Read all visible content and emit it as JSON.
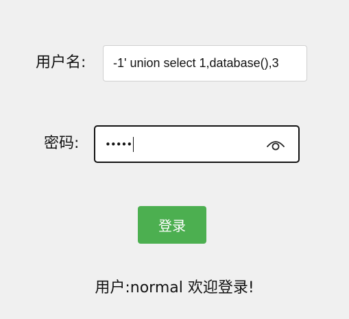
{
  "form": {
    "username_label": "用户名:",
    "username_value": "-1' union select 1,database(),3",
    "password_label": "密码:",
    "password_masked": "•••••",
    "show_password_icon": "eye-icon",
    "login_button": "登录"
  },
  "result": {
    "message": "用户:normal 欢迎登录!"
  },
  "colors": {
    "background": "#f0f0f0",
    "button": "#4caf50",
    "button_text": "#ffffff"
  }
}
